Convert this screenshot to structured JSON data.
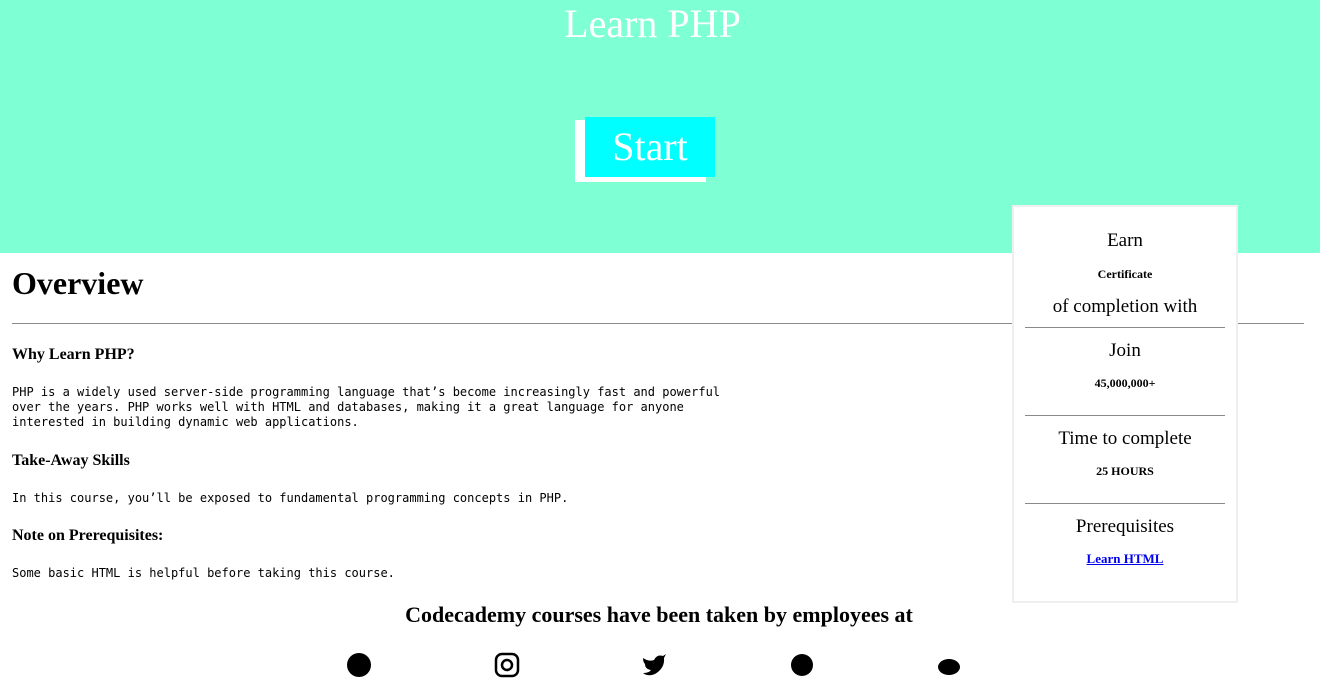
{
  "hero": {
    "title": "Learn PHP",
    "start_label": "Start"
  },
  "overview": {
    "title": "Overview",
    "sections": [
      {
        "heading": "Why Learn PHP?",
        "body": "PHP is a widely used server-side programming language that’s become increasingly fast and powerful\nover the years. PHP works well with HTML and databases, making it a great language for anyone\ninterested in building dynamic web applications."
      },
      {
        "heading": "Take-Away Skills",
        "body": "In this course, you’ll be exposed to fundamental programming concepts in PHP."
      },
      {
        "heading": "Note on Prerequisites:",
        "body": "Some basic HTML is helpful before taking this course."
      }
    ]
  },
  "card": {
    "earn_label": "Earn",
    "certificate_label": "Certificate",
    "completion_label": "of completion with",
    "join_label": "Join",
    "learners_count": "45,000,000+",
    "time_label": "Time to complete",
    "time_value": "25 HOURS",
    "prereq_label": "Prerequisites",
    "prereq_link": "Learn HTML"
  },
  "employers": {
    "heading": "Codecademy courses have been taken by employees at",
    "icons": [
      "pinterest-icon",
      "instagram-icon",
      "twitter-icon",
      "skype-icon",
      "reddit-icon"
    ]
  },
  "colors": {
    "hero_bg": "#7fffd4",
    "start_bg": "#00ffff",
    "link": "#0000ee"
  }
}
